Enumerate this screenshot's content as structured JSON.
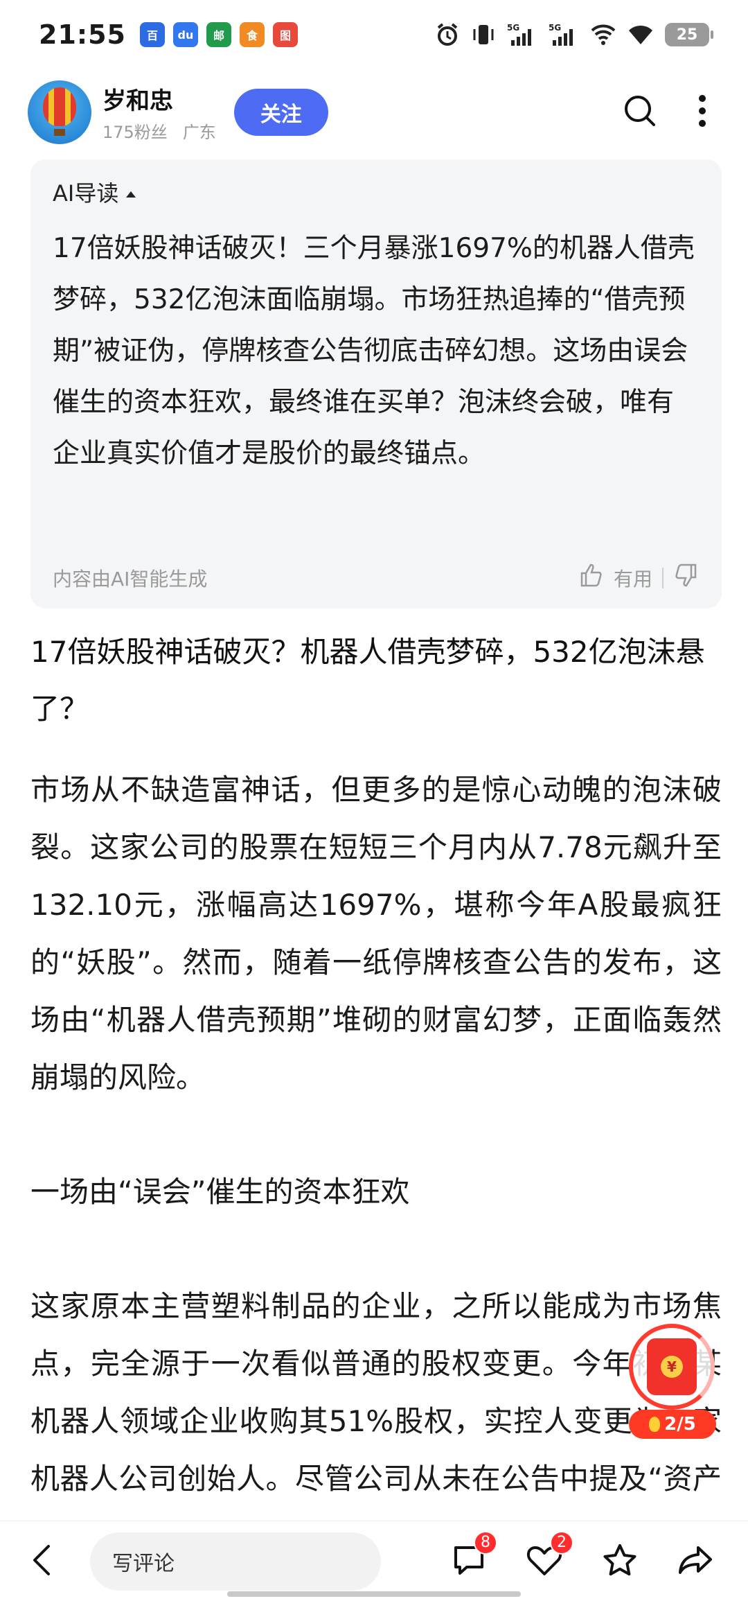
{
  "status": {
    "time": "21:55",
    "apps": [
      {
        "icon": "baidu-icon",
        "color": "#2d6be3",
        "glyph": "百"
      },
      {
        "icon": "du-icon",
        "color": "#3377ee",
        "glyph": "du"
      },
      {
        "icon": "china-post-icon",
        "color": "#1f9b4b",
        "glyph": "邮"
      },
      {
        "icon": "food-app-icon",
        "color": "#f28a24",
        "glyph": "食"
      },
      {
        "icon": "map-icon",
        "color": "#e9483c",
        "glyph": "图"
      }
    ],
    "battery": "25"
  },
  "author": {
    "name": "岁和忠",
    "followers": "175粉丝",
    "location": "广东",
    "follow_label": "关注"
  },
  "ai_summary": {
    "title": "AI导读",
    "text": "17倍妖股神话破灭！三个月暴涨1697%的机器人借壳梦碎，532亿泡沫面临崩塌。市场狂热追捧的“借壳预期”被证伪，停牌核查公告彻底击碎幻想。这场由误会催生的资本狂欢，最终谁在买单？泡沫终会破，唯有企业真实价值才是股价的最终锚点。",
    "footer": "内容由AI智能生成",
    "useful_label": "有用"
  },
  "article": {
    "title": "17倍妖股神话破灭？机器人借壳梦碎，532亿泡沫悬了？",
    "p1": "市场从不缺造富神话，但更多的是惊心动魄的泡沫破裂。这家公司的股票在短短三个月内从7.78元飙升至132.10元，涨幅高达1697%，堪称今年A股最疯狂的“妖股”。然而，随着一纸停牌核查公告的发布，这场由“机器人借壳预期”堆砌的财富幻梦，正面临轰然崩塌的风险。",
    "section": "一场由“误会”催生的资本狂欢",
    "p2": "这家原本主营塑料制品的企业，之所以能成为市场焦点，完全源于一次看似普通的股权变更。今年初，某机器人领域企业收购其51%股权，实控人变更为一家机器人公司创始人。尽管公司从未在公告中提及“资产注入”或“借壳上"
  },
  "float": {
    "coin_glyph": "¥",
    "progress": "2/5"
  },
  "bottom": {
    "comment_placeholder": "写评论",
    "comment_count": "8",
    "like_count": "2"
  }
}
